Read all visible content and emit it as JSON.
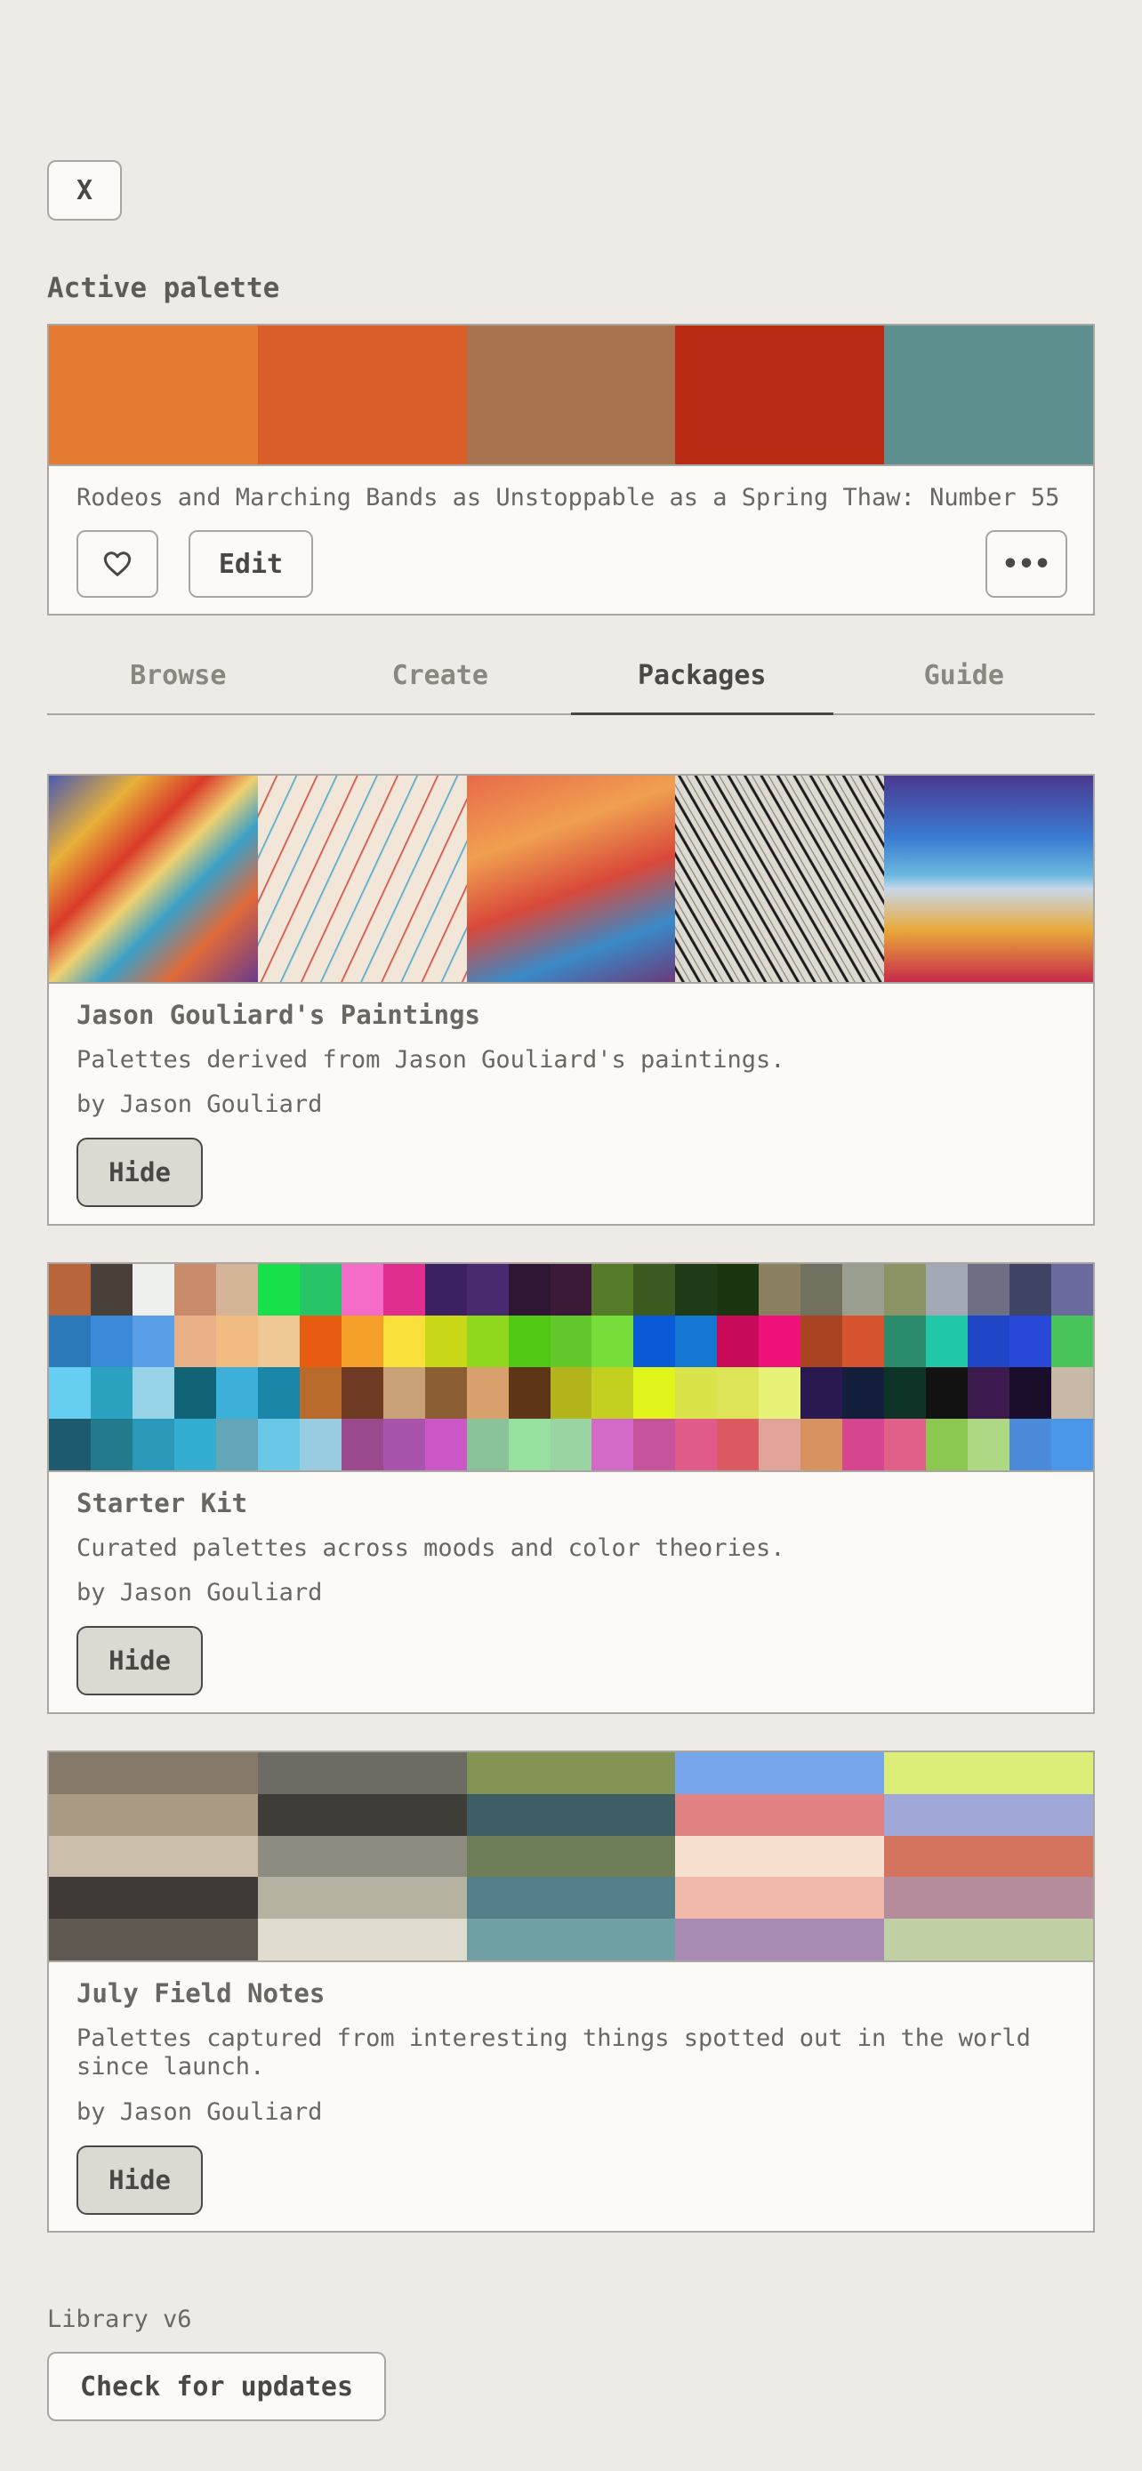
{
  "close_label": "X",
  "active": {
    "section_label": "Active palette",
    "swatches": [
      "#e57a32",
      "#d95e27",
      "#a9734f",
      "#b82a14",
      "#5e8f8f"
    ],
    "name": "Rodeos and Marching Bands as Unstoppable as a Spring Thaw: Number 55",
    "edit_label": "Edit",
    "more_label": "•••"
  },
  "tabs": [
    "Browse",
    "Create",
    "Packages",
    "Guide"
  ],
  "active_tab": "Packages",
  "packages": [
    {
      "title": "Jason Gouliard's Paintings",
      "description": "Palettes derived from Jason Gouliard's paintings.",
      "author": "by Jason Gouliard",
      "hide_label": "Hide",
      "preview_colors": [
        "#e8b03a",
        "#f2e6d8",
        "#e0603e",
        "#d8d4cc",
        "#4a3a90"
      ]
    },
    {
      "title": "Starter Kit",
      "description": "Curated palettes across moods and color theories.",
      "author": "by Jason Gouliard",
      "hide_label": "Hide",
      "swatch_grid": [
        [
          "#b8653c",
          "#4a403a",
          "#eef0ee",
          "#c98b6c",
          "#d3b496",
          "#18e04a",
          "#28c468",
          "#f56bc8",
          "#e02e8e",
          "#3b2062",
          "#4a2a6e",
          "#2e1634",
          "#3a1a36",
          "#567c2a",
          "#3d5a20",
          "#1e3a16",
          "#1a3410",
          "#8a8060",
          "#72705e",
          "#9a9e8e",
          "#8c9466",
          "#a2a8b4",
          "#6e6e84",
          "#404464",
          "#6a6a9e"
        ],
        [
          "#2a78b8",
          "#3a8ad8",
          "#5a9ee8",
          "#e8b086",
          "#f0bc82",
          "#f0c896",
          "#e85c12",
          "#f5a028",
          "#fae03a",
          "#c8d818",
          "#90d81e",
          "#50c814",
          "#62c82c",
          "#76dd3a",
          "#0a5ad8",
          "#1478d2",
          "#c80a5a",
          "#f0107a",
          "#a84422",
          "#d65430",
          "#2a8c6c",
          "#20c8a8",
          "#2046c8",
          "#2848d8",
          "#48c45a"
        ],
        [
          "#66cef0",
          "#2aa2c0",
          "#98d2e6",
          "#106476",
          "#3cb0d8",
          "#1a86a8",
          "#b86a2a",
          "#6e3a24",
          "#c8a276",
          "#8c5e34",
          "#d8a06c",
          "#5c3616",
          "#b4b41c",
          "#c4d020",
          "#def41a",
          "#d8e44a",
          "#dee458",
          "#e8f276",
          "#2a1850",
          "#121e3a",
          "#0e3428",
          "#121212",
          "#3c1a4e",
          "#1a0e2a",
          "#c8b8a8"
        ],
        [
          "#1e5a6e",
          "#237a8c",
          "#2a98b8",
          "#34aed0",
          "#64a6b8",
          "#6ac8e6",
          "#98cce0",
          "#9a4a8c",
          "#a854ac",
          "#cc58c8",
          "#8ac29a",
          "#98e0a0",
          "#9ad4a2",
          "#d46ac8",
          "#c6549a",
          "#e05a8a",
          "#dc5a62",
          "#e0a49a",
          "#d89262",
          "#d6468e",
          "#e0608a",
          "#8cc850",
          "#aed884",
          "#4a8ad8",
          "#4a96e8"
        ]
      ]
    },
    {
      "title": "July Field Notes",
      "description": "Palettes captured from interesting things spotted out in the world since launch.",
      "author": "by Jason Gouliard",
      "hide_label": "Hide",
      "swatch_columns": [
        [
          "#857a6a",
          "#a99a84",
          "#cbbfac",
          "#403a36",
          "#5f5850"
        ],
        [
          "#6c6b64",
          "#3e3d38",
          "#8e8c80",
          "#b6b2a2",
          "#e0ddd0"
        ],
        [
          "#849454",
          "#3c5e64",
          "#6e7e58",
          "#528088",
          "#6ea0a4"
        ],
        [
          "#78a6ec",
          "#e08282",
          "#f8e0d0",
          "#f0b8a8",
          "#a88cb4"
        ],
        [
          "#dcee78",
          "#a0a8d8",
          "#d4745e",
          "#b48c9c",
          "#c0d0a4"
        ]
      ]
    }
  ],
  "library": {
    "version_label": "Library v6",
    "check_updates_label": "Check for updates"
  }
}
